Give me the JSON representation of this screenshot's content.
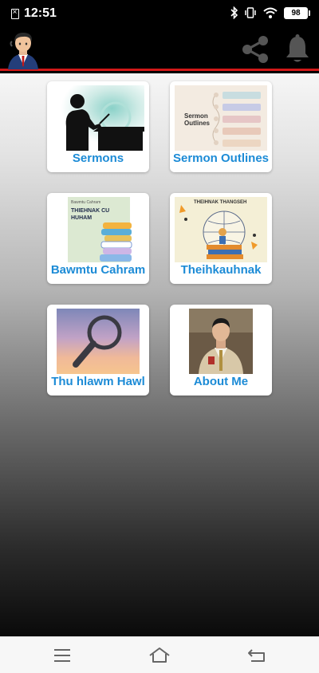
{
  "status_bar": {
    "time": "12:51",
    "battery": "98"
  },
  "app_bar": {
    "avatar_icon": "preacher-avatar-icon",
    "share_icon": "share-icon",
    "bell_icon": "bell-icon"
  },
  "accent_colors": {
    "header_underline": "#d21818",
    "card_label": "#1c8bd6"
  },
  "cards": [
    {
      "label": "Sermons",
      "image": "preacher-silhouette"
    },
    {
      "label": "Sermon Outlines",
      "image": "outline-timeline",
      "image_text": {
        "title_line1": "Sermon",
        "title_line2": "Outlines"
      }
    },
    {
      "label": "Bawmtu Cahram",
      "image": "book-cover",
      "image_text": {
        "small": "Bawmtu Cahram",
        "title_line1": "THIEHNAK CU",
        "title_line2": "HUHAM"
      }
    },
    {
      "label": "Theihkauhnak",
      "image": "books-globe",
      "image_text": {
        "title": "THEIHNAK THANGSEH"
      }
    },
    {
      "label": "Thu hlawm Hawl",
      "image": "magnifying-glass"
    },
    {
      "label": "About Me",
      "image": "speaker-photo"
    }
  ],
  "nav_bar": {
    "menu_icon": "menu-icon",
    "home_icon": "home-icon",
    "back_icon": "back-icon"
  }
}
